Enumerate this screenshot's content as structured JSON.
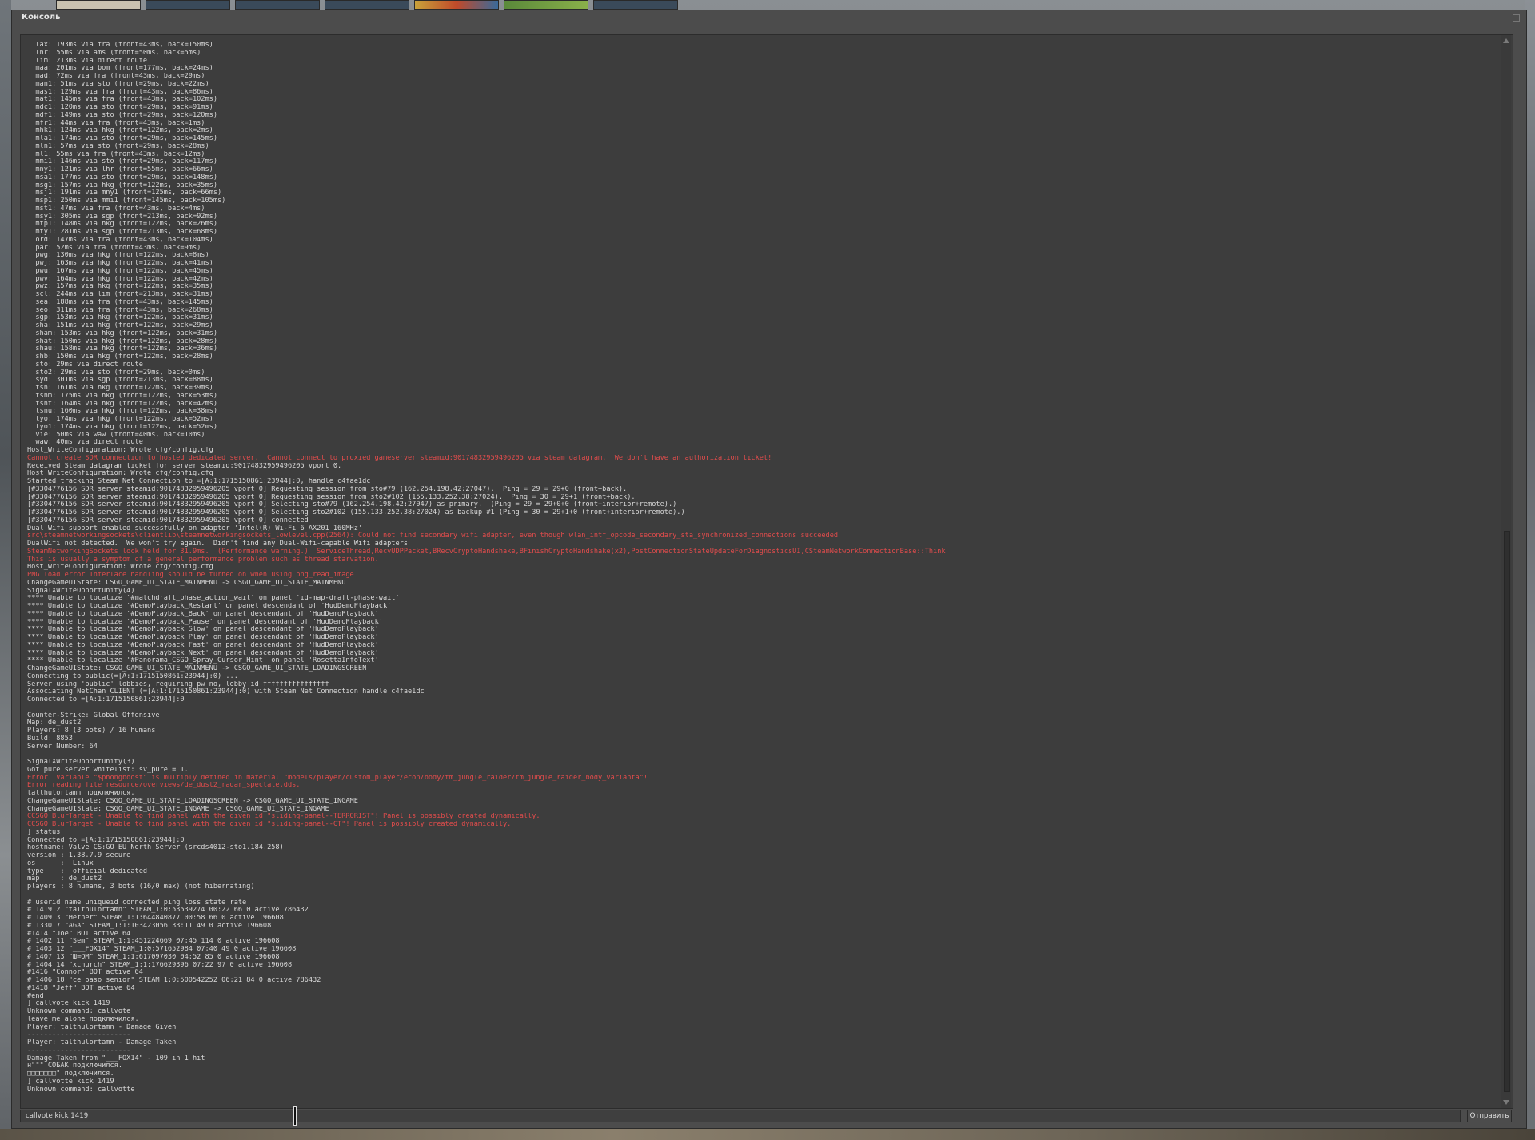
{
  "window": {
    "title": "Консоль"
  },
  "input": {
    "value": "callvote kick 1419",
    "submit_label": "Отправить"
  },
  "colors": {
    "error": "#e24c4c",
    "normal": "#d8d8d8",
    "panel": "#3d3d3d"
  },
  "lines": [
    {
      "t": "  lax: 193ms via fra (front=43ms, back=150ms)"
    },
    {
      "t": "  lhr: 55ms via ams (front=50ms, back=5ms)"
    },
    {
      "t": "  lim: 213ms via direct route"
    },
    {
      "t": "  maa: 201ms via bom (front=177ms, back=24ms)"
    },
    {
      "t": "  mad: 72ms via fra (front=43ms, back=29ms)"
    },
    {
      "t": "  man1: 51ms via sto (front=29ms, back=22ms)"
    },
    {
      "t": "  mas1: 129ms via fra (front=43ms, back=86ms)"
    },
    {
      "t": "  mat1: 145ms via fra (front=43ms, back=102ms)"
    },
    {
      "t": "  mdc1: 120ms via sto (front=29ms, back=91ms)"
    },
    {
      "t": "  mdf1: 149ms via sto (front=29ms, back=120ms)"
    },
    {
      "t": "  mfr1: 44ms via fra (front=43ms, back=1ms)"
    },
    {
      "t": "  mhk1: 124ms via hkg (front=122ms, back=2ms)"
    },
    {
      "t": "  mla1: 174ms via sto (front=29ms, back=145ms)"
    },
    {
      "t": "  mln1: 57ms via sto (front=29ms, back=28ms)"
    },
    {
      "t": "  ml1: 55ms via fra (front=43ms, back=12ms)"
    },
    {
      "t": "  mmi1: 146ms via sto (front=29ms, back=117ms)"
    },
    {
      "t": "  mny1: 121ms via lhr (front=55ms, back=66ms)"
    },
    {
      "t": "  msa1: 177ms via sto (front=29ms, back=148ms)"
    },
    {
      "t": "  msg1: 157ms via hkg (front=122ms, back=35ms)"
    },
    {
      "t": "  msj1: 191ms via mny1 (front=125ms, back=66ms)"
    },
    {
      "t": "  msp1: 250ms via mmi1 (front=145ms, back=105ms)"
    },
    {
      "t": "  mst1: 47ms via fra (front=43ms, back=4ms)"
    },
    {
      "t": "  msy1: 305ms via sgp (front=213ms, back=92ms)"
    },
    {
      "t": "  mtp1: 148ms via hkg (front=122ms, back=26ms)"
    },
    {
      "t": "  mty1: 281ms via sgp (front=213ms, back=68ms)"
    },
    {
      "t": "  ord: 147ms via fra (front=43ms, back=104ms)"
    },
    {
      "t": "  par: 52ms via fra (front=43ms, back=9ms)"
    },
    {
      "t": "  pwg: 130ms via hkg (front=122ms, back=8ms)"
    },
    {
      "t": "  pwj: 163ms via hkg (front=122ms, back=41ms)"
    },
    {
      "t": "  pwu: 167ms via hkg (front=122ms, back=45ms)"
    },
    {
      "t": "  pwv: 164ms via hkg (front=122ms, back=42ms)"
    },
    {
      "t": "  pwz: 157ms via hkg (front=122ms, back=35ms)"
    },
    {
      "t": "  scl: 244ms via lim (front=213ms, back=31ms)"
    },
    {
      "t": "  sea: 188ms via fra (front=43ms, back=145ms)"
    },
    {
      "t": "  seo: 311ms via fra (front=43ms, back=268ms)"
    },
    {
      "t": "  sgp: 153ms via hkg (front=122ms, back=31ms)"
    },
    {
      "t": "  sha: 151ms via hkg (front=122ms, back=29ms)"
    },
    {
      "t": "  sham: 153ms via hkg (front=122ms, back=31ms)"
    },
    {
      "t": "  shat: 150ms via hkg (front=122ms, back=28ms)"
    },
    {
      "t": "  shau: 158ms via hkg (front=122ms, back=36ms)"
    },
    {
      "t": "  shb: 150ms via hkg (front=122ms, back=28ms)"
    },
    {
      "t": "  sto: 29ms via direct route"
    },
    {
      "t": "  sto2: 29ms via sto (front=29ms, back=0ms)"
    },
    {
      "t": "  syd: 301ms via sgp (front=213ms, back=88ms)"
    },
    {
      "t": "  tsn: 161ms via hkg (front=122ms, back=39ms)"
    },
    {
      "t": "  tsnm: 175ms via hkg (front=122ms, back=53ms)"
    },
    {
      "t": "  tsnt: 164ms via hkg (front=122ms, back=42ms)"
    },
    {
      "t": "  tsnu: 160ms via hkg (front=122ms, back=38ms)"
    },
    {
      "t": "  tyo: 174ms via hkg (front=122ms, back=52ms)"
    },
    {
      "t": "  tyo1: 174ms via hkg (front=122ms, back=52ms)"
    },
    {
      "t": "  vie: 50ms via waw (front=40ms, back=10ms)"
    },
    {
      "t": "  waw: 40ms via direct route"
    },
    {
      "t": "Host_WriteConfiguration: Wrote cfg/config.cfg"
    },
    {
      "t": "Cannot create SDR connection to hosted dedicated server.  Cannot connect to proxied gameserver steamid:90174832959496205 via steam datagram.  We don't have an authorization ticket!",
      "e": true
    },
    {
      "t": "Received Steam datagram ticket for server steamid:90174832959496205 vport 0."
    },
    {
      "t": "Host_WriteConfiguration: Wrote cfg/config.cfg"
    },
    {
      "t": "Started tracking Steam Net Connection to =[A:1:1715150861:23944]:0, handle c4fae1dc"
    },
    {
      "t": "[#3304776156 SDR server steamid:90174832959496205 vport 0] Requesting session from sto#79 (162.254.198.42:27047).  Ping = 29 = 29+0 (front+back)."
    },
    {
      "t": "[#3304776156 SDR server steamid:90174832959496205 vport 0] Requesting session from sto2#102 (155.133.252.38:27024).  Ping = 30 = 29+1 (front+back)."
    },
    {
      "t": "[#3304776156 SDR server steamid:90174832959496205 vport 0] Selecting sto#79 (162.254.198.42:27047) as primary.  (Ping = 29 = 29+0+0 (front+interior+remote).)"
    },
    {
      "t": "[#3304776156 SDR server steamid:90174832959496205 vport 0] Selecting sto2#102 (155.133.252.38:27024) as backup #1 (Ping = 30 = 29+1+0 (front+interior+remote).)"
    },
    {
      "t": "[#3304776156 SDR server steamid:90174832959496205 vport 0] connected"
    },
    {
      "t": "Dual Wifi support enabled successfully on adapter 'Intel(R) Wi-Fi 6 AX201 160MHz'"
    },
    {
      "t": "src\\steamnetworkingsockets\\clientlib\\steamnetworkingsockets_lowlevel.cpp(2564): Could not find secondary wifi adapter, even though wlan_intf_opcode_secondary_sta_synchronized_connections succeeded",
      "e": true
    },
    {
      "t": "DualWifi not detected.  We won't try again.  Didn't find any Dual-Wifi-capable Wifi adapters"
    },
    {
      "t": "SteamNetworkingSockets lock held for 31.9ms.  (Performance warning.)  ServiceThread,RecvUDPPacket,BRecvCryptoHandshake,BFinishCryptoHandshake(x2),PostConnectionStateUpdateForDiagnosticsUI,CSteamNetworkConnectionBase::Think",
      "e": true
    },
    {
      "t": "This is usually a symptom of a general performance problem such as thread starvation.",
      "e": true
    },
    {
      "t": "Host_WriteConfiguration: Wrote cfg/config.cfg"
    },
    {
      "t": "PNG load error Interlace handling should be turned on when using png_read_image",
      "e": true
    },
    {
      "t": "ChangeGameUIState: CSGO_GAME_UI_STATE_MAINMENU -> CSGO_GAME_UI_STATE_MAINMENU"
    },
    {
      "t": "SignalXWriteOpportunity(4)"
    },
    {
      "t": "**** Unable to localize '#matchdraft_phase_action_wait' on panel 'id-map-draft-phase-wait'"
    },
    {
      "t": "**** Unable to localize '#DemoPlayback_Restart' on panel descendant of 'HudDemoPlayback'"
    },
    {
      "t": "**** Unable to localize '#DemoPlayback_Back' on panel descendant of 'HudDemoPlayback'"
    },
    {
      "t": "**** Unable to localize '#DemoPlayback_Pause' on panel descendant of 'HudDemoPlayback'"
    },
    {
      "t": "**** Unable to localize '#DemoPlayback_Slow' on panel descendant of 'HudDemoPlayback'"
    },
    {
      "t": "**** Unable to localize '#DemoPlayback_Play' on panel descendant of 'HudDemoPlayback'"
    },
    {
      "t": "**** Unable to localize '#DemoPlayback_Fast' on panel descendant of 'HudDemoPlayback'"
    },
    {
      "t": "**** Unable to localize '#DemoPlayback_Next' on panel descendant of 'HudDemoPlayback'"
    },
    {
      "t": "**** Unable to localize '#Panorama_CSGO_Spray_Cursor_Hint' on panel 'RosettaInfoText'"
    },
    {
      "t": "ChangeGameUIState: CSGO_GAME_UI_STATE_MAINMENU -> CSGO_GAME_UI_STATE_LOADINGSCREEN"
    },
    {
      "t": "Connecting to public(=[A:1:1715150861:23944]:0) ..."
    },
    {
      "t": "Server using 'public' lobbies, requiring pw no, lobby id ffffffffffffffff"
    },
    {
      "t": "Associating NetChan CLIENT (=[A:1:1715150861:23944]:0) with Steam Net Connection handle c4fae1dc"
    },
    {
      "t": "Connected to =[A:1:1715150861:23944]:0"
    },
    {
      "t": ""
    },
    {
      "t": "Counter-Strike: Global Offensive"
    },
    {
      "t": "Map: de_dust2"
    },
    {
      "t": "Players: 8 (3 bots) / 16 humans"
    },
    {
      "t": "Build: 8853"
    },
    {
      "t": "Server Number: 64"
    },
    {
      "t": ""
    },
    {
      "t": "SignalXWriteOpportunity(3)"
    },
    {
      "t": "Got pure server whitelist: sv_pure = 1."
    },
    {
      "t": "Error! Variable \"$phongboost\" is multiply defined in material \"models/player/custom_player/econ/body/tm_jungle_raider/tm_jungle_raider_body_variantа\"!",
      "e": true
    },
    {
      "t": "Error reading file resource/overviews/de_dust2_radar_spectate.dds.",
      "e": true
    },
    {
      "t": "talthulortamn подключился."
    },
    {
      "t": "ChangeGameUIState: CSGO_GAME_UI_STATE_LOADINGSCREEN -> CSGO_GAME_UI_STATE_INGAME"
    },
    {
      "t": "ChangeGameUIState: CSGO_GAME_UI_STATE_INGAME -> CSGO_GAME_UI_STATE_INGAME"
    },
    {
      "t": "CCSGO_BlurTarget - Unable to find panel with the given id \"sliding-panel--TERRORIST\"! Panel is possibly created dynamically.",
      "e": true
    },
    {
      "t": "CCSGO_BlurTarget - Unable to find panel with the given id \"sliding-panel--CT\"! Panel is possibly created dynamically.",
      "e": true
    },
    {
      "t": "] status"
    },
    {
      "t": "Connected to =[A:1:1715150861:23944]:0"
    },
    {
      "t": "hostname: Valve CS:GO EU North Server (srcds4012-sto1.184.258)"
    },
    {
      "t": "version : 1.38.7.9 secure"
    },
    {
      "t": "os      :  Linux"
    },
    {
      "t": "type    :  official dedicated"
    },
    {
      "t": "map     : de_dust2"
    },
    {
      "t": "players : 8 humans, 3 bots (16/0 max) (not hibernating)"
    },
    {
      "t": ""
    },
    {
      "t": "# userid name uniqueid connected ping loss state rate"
    },
    {
      "t": "# 1419 2 \"talthulortamn\" STEAM_1:0:53539274 00:22 66 0 active 786432"
    },
    {
      "t": "# 1409 3 \"Hefner\" STEAM_1:1:644840877 00:58 66 0 active 196608"
    },
    {
      "t": "# 1330 7 \"AGA\" STEAM_1:1:103423056 33:11 49 0 active 196608"
    },
    {
      "t": "#1414 \"Joe\" BOT active 64"
    },
    {
      "t": "# 1402 11 \"Sem\" STEAM_1:1:451224669 07:45 114 0 active 196608"
    },
    {
      "t": "# 1403 12 \"___FOX14\" STEAM_1:0:571652984 07:40 49 0 active 196608"
    },
    {
      "t": "# 1407 13 \"Ш=ОМ\" STEAM_1:1:617097030 04:52 85 0 active 196608"
    },
    {
      "t": "# 1404 14 \"xchurch\" STEAM_1:1:176629396 07:22 97 0 active 196608"
    },
    {
      "t": "#1416 \"Connor\" BOT active 64"
    },
    {
      "t": "# 1406 18 \"ce paso senior\" STEAM_1:0:500542252 06:21 84 0 active 786432"
    },
    {
      "t": "#1418 \"Jeff\" BOT active 64"
    },
    {
      "t": "#end"
    },
    {
      "t": "] callvote kick 1419"
    },
    {
      "t": "Unknown command: callvote"
    },
    {
      "t": "leave me alone подключился."
    },
    {
      "t": "Player: talthulortamn - Damage Given"
    },
    {
      "t": "-------------------------"
    },
    {
      "t": "Player: talthulortamn - Damage Taken"
    },
    {
      "t": "-------------------------"
    },
    {
      "t": "Damage Taken from \"___FOX14\" - 109 in 1 hit"
    },
    {
      "t": "н\"\"\" СОБАК подключился."
    },
    {
      "t": "□□□□□□□\" подключился."
    },
    {
      "t": "] callvotte kick 1419"
    },
    {
      "t": "Unknown command: callvotte"
    }
  ]
}
